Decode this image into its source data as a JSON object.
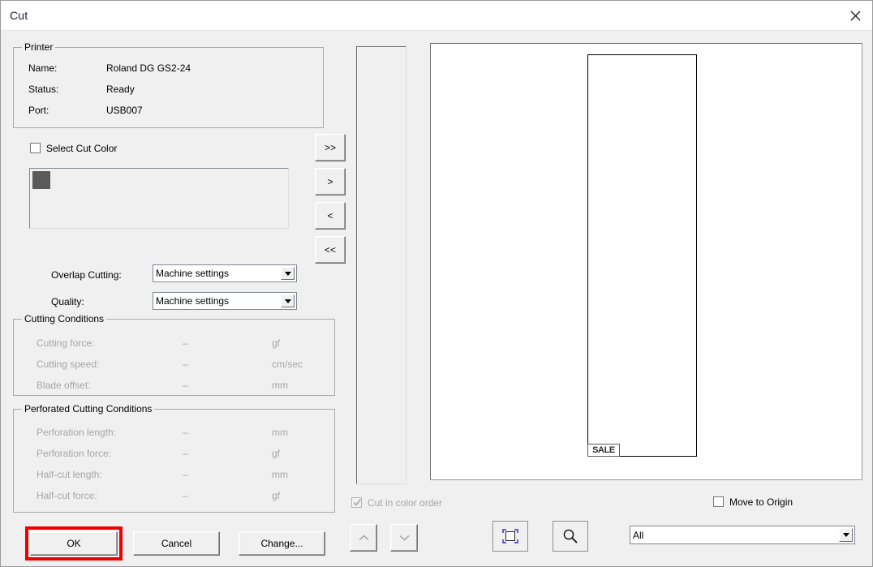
{
  "window": {
    "title": "Cut",
    "close_icon": "close-icon"
  },
  "printer_group": {
    "title": "Printer",
    "rows": [
      {
        "label": "Name:",
        "value": "Roland DG GS2-24"
      },
      {
        "label": "Status:",
        "value": "Ready"
      },
      {
        "label": "Port:",
        "value": "USB007"
      }
    ]
  },
  "cut_color": {
    "checkbox_label": "Select Cut Color",
    "checked": false,
    "swatch_color": "#5a5a5a"
  },
  "transfer_buttons": [
    {
      "label": ">>",
      "name": "move-all-right-button"
    },
    {
      "label": ">",
      "name": "move-right-button"
    },
    {
      "label": "<",
      "name": "move-left-button"
    },
    {
      "label": "<<",
      "name": "move-all-left-button"
    }
  ],
  "settings": {
    "overlap_label": "Overlap Cutting:",
    "overlap_value": "Machine settings",
    "quality_label": "Quality:",
    "quality_value": "Machine settings"
  },
  "cutting_conditions": {
    "title": "Cutting Conditions",
    "rows": [
      {
        "label": "Cutting force:",
        "value": "–",
        "unit": "gf"
      },
      {
        "label": "Cutting speed:",
        "value": "–",
        "unit": "cm/sec"
      },
      {
        "label": "Blade offset:",
        "value": "–",
        "unit": "mm"
      }
    ]
  },
  "perforated_conditions": {
    "title": "Perforated Cutting Conditions",
    "rows": [
      {
        "label": "Perforation length:",
        "value": "–",
        "unit": "mm"
      },
      {
        "label": "Perforation  force:",
        "value": "–",
        "unit": "gf"
      },
      {
        "label": "Half-cut length:",
        "value": "–",
        "unit": "mm"
      },
      {
        "label": "Half-cut force:",
        "value": "–",
        "unit": "gf"
      }
    ]
  },
  "footer": {
    "ok_label": "OK",
    "cancel_label": "Cancel",
    "change_label": "Change...",
    "highlight_color": "#ee0000"
  },
  "preview": {
    "cut_in_color_order_label": "Cut in color order",
    "cut_in_color_order_checked": true,
    "cut_in_color_order_enabled": false,
    "move_to_origin_label": "Move to Origin",
    "move_to_origin_checked": false,
    "object_label": "SALE",
    "up_icon": "chevron-up-icon",
    "down_icon": "chevron-down-icon",
    "fit_icon": "fit-to-window-icon",
    "zoom_icon": "magnifier-icon",
    "filter_value": "All"
  }
}
